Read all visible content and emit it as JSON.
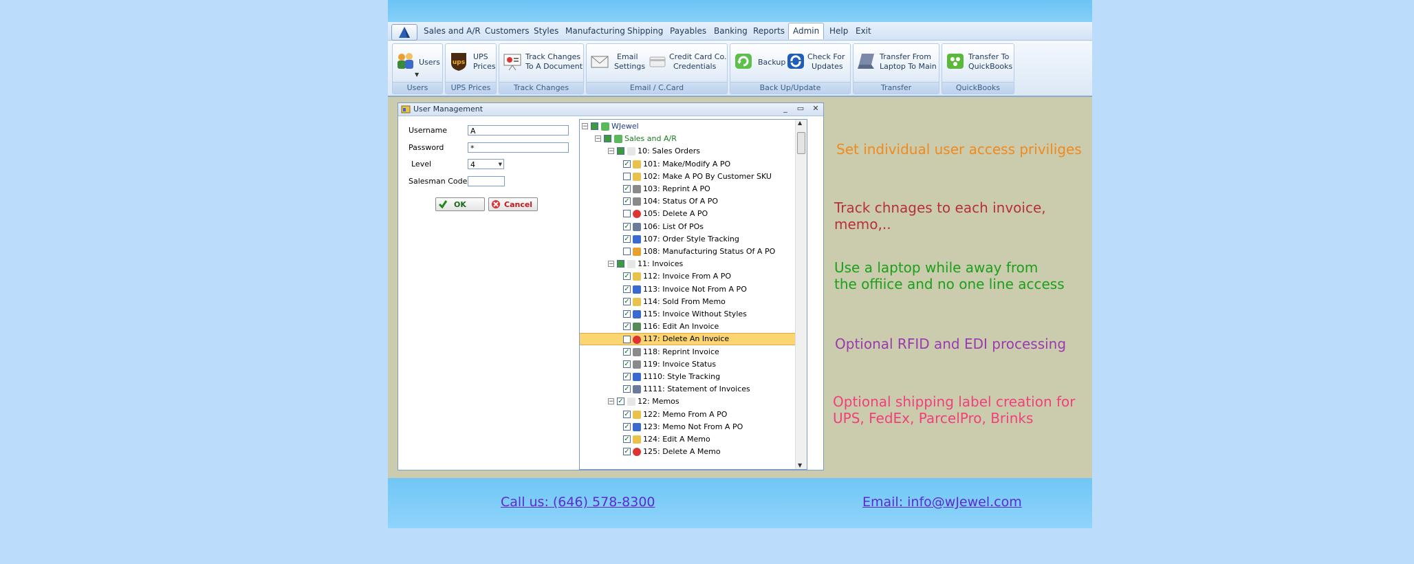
{
  "menu": {
    "items": [
      "Sales and A/R",
      "Customers",
      "Styles",
      "Manufacturing",
      "Shipping",
      "Payables",
      "Banking",
      "Reports",
      "Admin",
      "Help",
      "Exit"
    ],
    "active": "Admin"
  },
  "ribbon": {
    "users_group": {
      "button": "Users",
      "label": "Users"
    },
    "ups_group": {
      "button_line1": "UPS",
      "button_line2": "Prices",
      "label": "UPS Prices"
    },
    "track_group": {
      "button_line1": "Track Changes",
      "button_line2": "To A Document",
      "label": "Track Changes"
    },
    "email_group": {
      "email_line1": "Email",
      "email_line2": "Settings",
      "cc_line1": "Credit Card Co.",
      "cc_line2": "Credentials",
      "label": "Email / C.Card"
    },
    "backup_group": {
      "backup": "Backup",
      "check_line1": "Check For",
      "check_line2": "Updates",
      "label": "Back Up/Update"
    },
    "transfer_group": {
      "line1": "Transfer From",
      "line2": "Laptop To Main",
      "label": "Transfer"
    },
    "qb_group": {
      "line1": "Transfer To",
      "line2": "QuickBooks",
      "label": "QuickBooks"
    }
  },
  "dialog": {
    "title": "User Management",
    "username_label": "Username",
    "username_value": "A",
    "password_label": "Password",
    "password_value": "*",
    "level_label": "Level",
    "level_value": "4",
    "salesman_label": "Salesman Code",
    "salesman_value": "",
    "ok": "OK",
    "cancel": "Cancel"
  },
  "tree": [
    {
      "label": "WJewel",
      "depth": 0,
      "expander": true,
      "checked": null,
      "color": "#1a3a8a"
    },
    {
      "label": "Sales and A/R",
      "depth": 1,
      "expander": true,
      "checked": null,
      "color": "#1a7a1a"
    },
    {
      "label": "10: Sales Orders",
      "depth": 2,
      "expander": true,
      "checked": null,
      "color": "#000"
    },
    {
      "label": "101: Make/Modify A PO",
      "depth": 3,
      "checked": true,
      "icon": "#e8c24a"
    },
    {
      "label": "102: Make A PO By Customer SKU",
      "depth": 3,
      "checked": false,
      "icon": "#e8c24a"
    },
    {
      "label": "103: Reprint A PO",
      "depth": 3,
      "checked": true,
      "icon": "#8a8a8a"
    },
    {
      "label": "104: Status Of A PO",
      "depth": 3,
      "checked": true,
      "icon": "#8a8a8a"
    },
    {
      "label": "105: Delete A PO",
      "depth": 3,
      "checked": false,
      "icon": "#d33"
    },
    {
      "label": "106: List Of POs",
      "depth": 3,
      "checked": true,
      "icon": "#6a7a9a"
    },
    {
      "label": "107: Order Style Tracking",
      "depth": 3,
      "checked": true,
      "icon": "#3a6ad0"
    },
    {
      "label": "108: Manufacturing Status Of A PO",
      "depth": 3,
      "checked": false,
      "icon": "#e8a030"
    },
    {
      "label": "11: Invoices",
      "depth": 2,
      "expander": true,
      "checked": null,
      "color": "#000"
    },
    {
      "label": "112: Invoice From A PO",
      "depth": 3,
      "checked": true,
      "icon": "#e8c24a"
    },
    {
      "label": "113: Invoice Not From A PO",
      "depth": 3,
      "checked": true,
      "icon": "#3a6ad0"
    },
    {
      "label": "114: Sold From Memo",
      "depth": 3,
      "checked": true,
      "icon": "#e8c24a"
    },
    {
      "label": "115: Invoice Without Styles",
      "depth": 3,
      "checked": true,
      "icon": "#3a6ad0"
    },
    {
      "label": "116: Edit An Invoice",
      "depth": 3,
      "checked": true,
      "icon": "#5a8a5a"
    },
    {
      "label": "117: Delete An Invoice",
      "depth": 3,
      "checked": false,
      "icon": "#d33",
      "selected": true
    },
    {
      "label": "118: Reprint Invoice",
      "depth": 3,
      "checked": true,
      "icon": "#8a8a8a"
    },
    {
      "label": "119: Invoice Status",
      "depth": 3,
      "checked": true,
      "icon": "#8a8a8a"
    },
    {
      "label": "1110: Style Tracking",
      "depth": 3,
      "checked": true,
      "icon": "#3a6ad0"
    },
    {
      "label": "1111: Statement of Invoices",
      "depth": 3,
      "checked": true,
      "icon": "#6a7a9a"
    },
    {
      "label": "12: Memos",
      "depth": 2,
      "expander": true,
      "checked": true,
      "color": "#000"
    },
    {
      "label": "122: Memo From A PO",
      "depth": 3,
      "checked": true,
      "icon": "#e8c24a"
    },
    {
      "label": "123: Memo Not From A PO",
      "depth": 3,
      "checked": true,
      "icon": "#3a6ad0"
    },
    {
      "label": "124: Edit A Memo",
      "depth": 3,
      "checked": true,
      "icon": "#e8c24a"
    },
    {
      "label": "125: Delete A Memo",
      "depth": 3,
      "checked": true,
      "icon": "#d33"
    }
  ],
  "promos": [
    {
      "lines": [
        "Set individual user access priviliges"
      ],
      "color": "#f08a1c"
    },
    {
      "lines": [
        "Track chnages to each invoice,",
        "memo,.."
      ],
      "color": "#b5303a"
    },
    {
      "lines": [
        "Use a laptop while away from",
        "the offiice and no one line access"
      ],
      "color": "#1aa01a"
    },
    {
      "lines": [
        "Optional RFID and EDI processing"
      ],
      "color": "#9a3ab0"
    },
    {
      "lines": [
        "Optional shipping label creation for",
        "UPS, FedEx, ParcelPro, Brinks"
      ],
      "color": "#f0407a"
    }
  ],
  "footer": {
    "phone": "Call us: (646) 578-8300",
    "email": "Email: info@wJewel.com"
  }
}
